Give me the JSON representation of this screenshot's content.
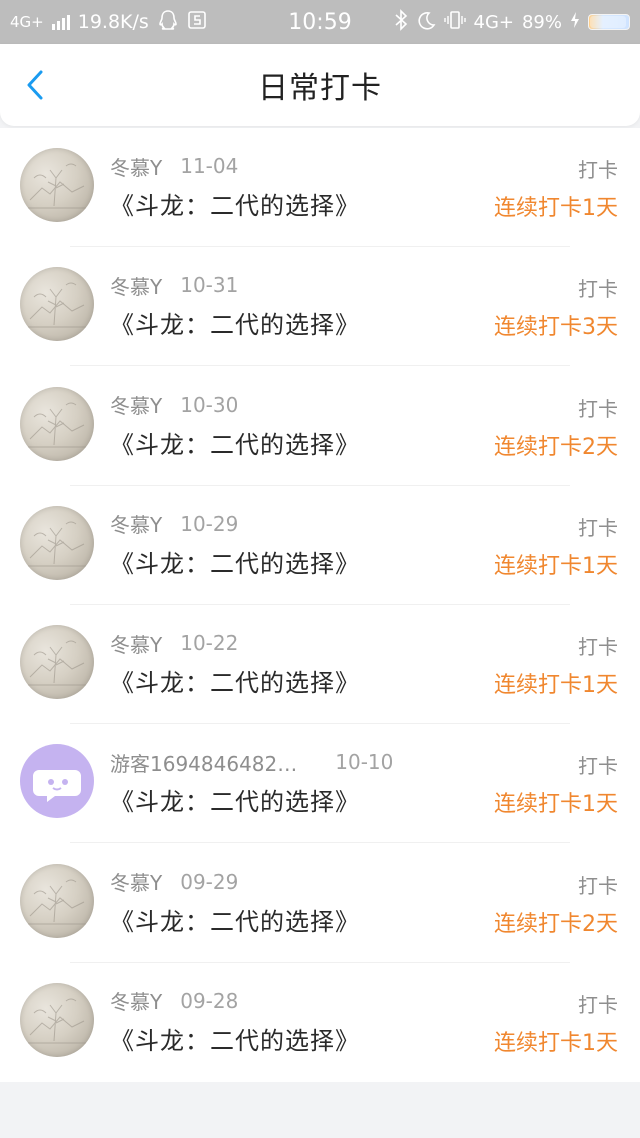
{
  "status_bar": {
    "network_left": "4G+",
    "speed": "19.8K/s",
    "time": "10:59",
    "network_right": "4G+",
    "battery": "89%",
    "battery_level": 0.89
  },
  "header": {
    "title": "日常打卡"
  },
  "checkins": [
    {
      "user": "冬慕Y",
      "date": "11-04",
      "book": "《斗龙：二代的选择》",
      "tag": "打卡",
      "streak": "连续打卡1天",
      "avatar": "landscape"
    },
    {
      "user": "冬慕Y",
      "date": "10-31",
      "book": "《斗龙：二代的选择》",
      "tag": "打卡",
      "streak": "连续打卡3天",
      "avatar": "landscape"
    },
    {
      "user": "冬慕Y",
      "date": "10-30",
      "book": "《斗龙：二代的选择》",
      "tag": "打卡",
      "streak": "连续打卡2天",
      "avatar": "landscape"
    },
    {
      "user": "冬慕Y",
      "date": "10-29",
      "book": "《斗龙：二代的选择》",
      "tag": "打卡",
      "streak": "连续打卡1天",
      "avatar": "landscape"
    },
    {
      "user": "冬慕Y",
      "date": "10-22",
      "book": "《斗龙：二代的选择》",
      "tag": "打卡",
      "streak": "连续打卡1天",
      "avatar": "landscape"
    },
    {
      "user": "游客1694846482…",
      "date": "10-10",
      "book": "《斗龙：二代的选择》",
      "tag": "打卡",
      "streak": "连续打卡1天",
      "avatar": "guest"
    },
    {
      "user": "冬慕Y",
      "date": "09-29",
      "book": "《斗龙：二代的选择》",
      "tag": "打卡",
      "streak": "连续打卡2天",
      "avatar": "landscape"
    },
    {
      "user": "冬慕Y",
      "date": "09-28",
      "book": "《斗龙：二代的选择》",
      "tag": "打卡",
      "streak": "连续打卡1天",
      "avatar": "landscape"
    }
  ],
  "colors": {
    "accent_blue": "#1a9bf0",
    "streak_orange": "#f0872f",
    "guest_avatar": "#c5b3f0"
  }
}
